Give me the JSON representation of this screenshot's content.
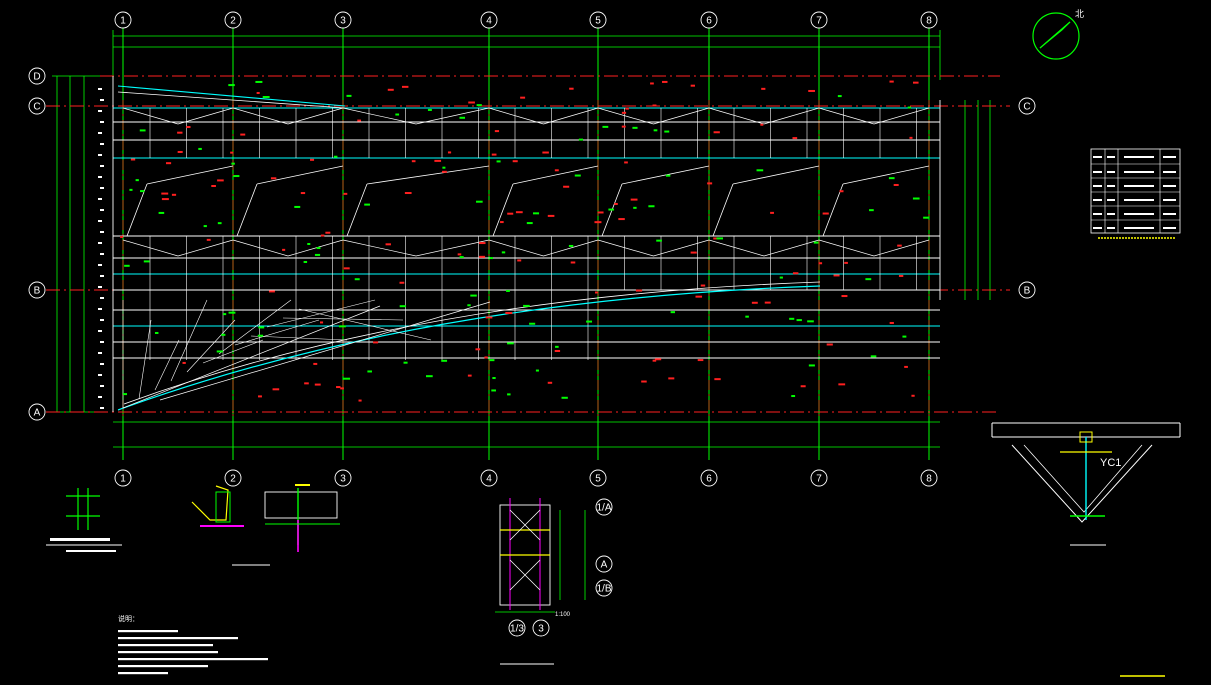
{
  "grid": {
    "columns": [
      "1",
      "2",
      "3",
      "4",
      "5",
      "6",
      "7",
      "8"
    ],
    "rows": [
      "A",
      "B",
      "C",
      "D"
    ],
    "detail_axes": [
      "1/3",
      "3"
    ],
    "detail_rows": [
      "1/A",
      "A",
      "1/B"
    ]
  },
  "labels": {
    "north": "北",
    "detail_yc": "YC1",
    "detail_scale": "1:100",
    "notes_title": "说明："
  },
  "colors": {
    "background": "#000000",
    "grid_green": "#00ff00",
    "axis_red": "#ff2020",
    "member_white": "#ffffff",
    "cyan": "#00ffff",
    "yellow": "#ffff00",
    "magenta": "#ff00ff"
  },
  "icons": [
    "north-arrow-icon"
  ]
}
